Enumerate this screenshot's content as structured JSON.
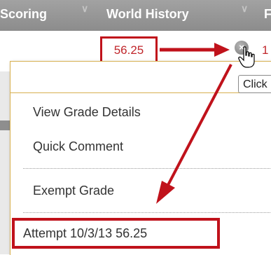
{
  "header": {
    "columns": [
      "-Scoring",
      "World History",
      "F"
    ]
  },
  "grade_cell": {
    "value": "56.25",
    "next_value": "1"
  },
  "tooltip": {
    "text": "Click"
  },
  "menu": {
    "items": [
      "View Grade Details",
      "Quick Comment",
      "Exempt Grade",
      "Attempt 10/3/13 56.25"
    ]
  },
  "colors": {
    "header_bg": "#999999",
    "highlight_red": "#c0121b",
    "grade_text": "#c0262b",
    "menu_border": "#d7b050"
  },
  "icons": [
    "chevron-down-icon",
    "dropdown-circle-icon",
    "hand-cursor-icon",
    "arrow-icon"
  ]
}
